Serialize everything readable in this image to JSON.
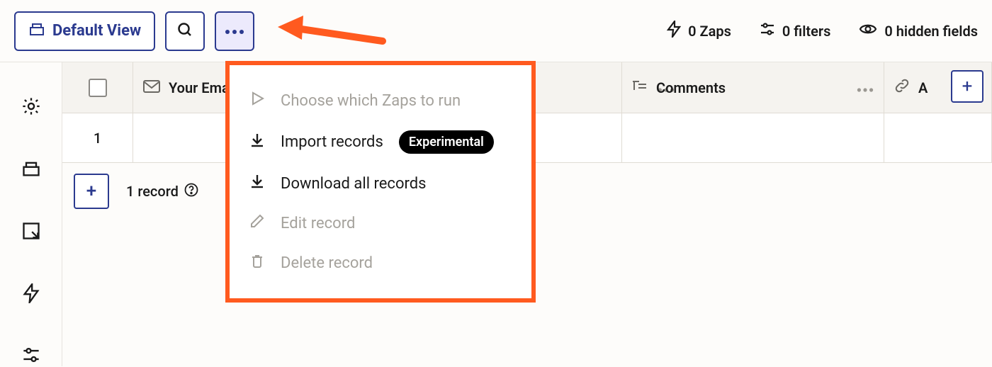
{
  "toolbar": {
    "view_label": "Default View",
    "stats": {
      "zaps": "0 Zaps",
      "filters": "0 filters",
      "hidden": "0 hidden fields"
    }
  },
  "columns": {
    "field1": "Your Email",
    "field2": "Comments",
    "field3": "A"
  },
  "rows": {
    "first_index": "1"
  },
  "footer": {
    "record_count": "1 record"
  },
  "menu": {
    "choose_zaps": "Choose which Zaps to run",
    "import": "Import records",
    "import_badge": "Experimental",
    "download": "Download all records",
    "edit": "Edit record",
    "delete": "Delete record"
  }
}
